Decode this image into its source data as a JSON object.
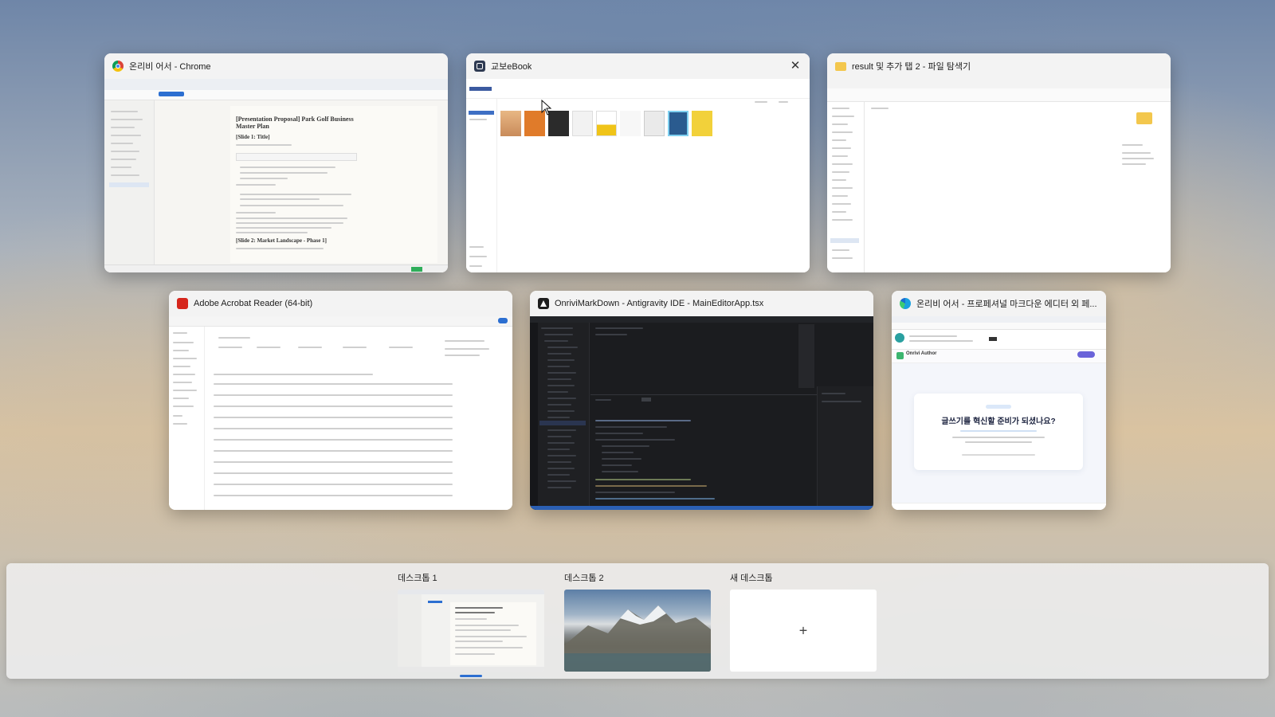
{
  "windows": [
    {
      "title": "온리비 어서 - Chrome",
      "icon": "chrome-icon",
      "doc_heading": "[Presentation Proposal] Park Golf Business Master Plan",
      "slide1": "[Slide 1: Title]",
      "slide2": "[Slide 2: Market Landscape - Phase 1]"
    },
    {
      "title": "교보eBook",
      "icon": "ebook-icon",
      "close": "✕"
    },
    {
      "title": "result 및 추가 탭 2 - 파일 탐색기",
      "icon": "folder-icon"
    },
    {
      "title": "Adobe Acrobat Reader (64-bit)",
      "icon": "acrobat-icon"
    },
    {
      "title": "OnriviMarkDown - Antigravity IDE - MainEditorApp.tsx",
      "icon": "antigravity-icon"
    },
    {
      "title": "온리비 어서 - 프로페셔널 마크다운 에디터 외 페...",
      "icon": "edge-icon",
      "brand": "Onrivi Author",
      "hero": "글쓰기를 혁신할 준비가 되셨나요?"
    }
  ],
  "desktops": [
    {
      "label": "데스크톱 1",
      "active": true
    },
    {
      "label": "데스크톱 2",
      "active": false
    },
    {
      "label": "새 데스크톱",
      "plus": "+"
    }
  ],
  "colors": {
    "accent": "#2c6fd1",
    "chrome_red": "#db4437",
    "folder": "#f3c74d",
    "acrobat": "#d6261c"
  }
}
